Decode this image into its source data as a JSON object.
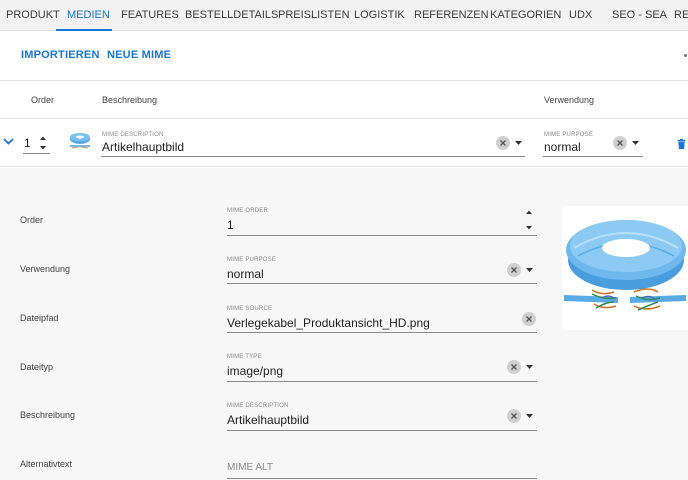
{
  "tabs": [
    "PRODUKT",
    "MEDIEN",
    "FEATURES",
    "BESTELLDETAILS",
    "PREISLISTEN",
    "LOGISTIK",
    "REFERENZEN",
    "KATEGORIEN",
    "UDX",
    "SEO - SEA",
    "REG"
  ],
  "active_tab": "MEDIEN",
  "actions": {
    "import_label": "IMPORTIEREN",
    "new_mime_label": "NEUE MIME"
  },
  "table": {
    "headers": {
      "order": "Order",
      "description": "Beschreibung",
      "usage": "Verwendung"
    },
    "row": {
      "order": "1",
      "description_label": "MIME DESCRIPTION",
      "description": "Artikelhauptbild",
      "purpose_label": "MIME PURPOSE",
      "purpose": "normal"
    }
  },
  "details": {
    "order": {
      "label": "Order",
      "field_label": "MIME ORDER",
      "value": "1"
    },
    "usage": {
      "label": "Verwendung",
      "field_label": "MIME PURPOSE",
      "value": "normal"
    },
    "path": {
      "label": "Dateipfad",
      "field_label": "MIME SOURCE",
      "value": "Verlegekabel_Produktansicht_HD.png"
    },
    "type": {
      "label": "Dateityp",
      "field_label": "MIME TYPE",
      "value": "image/png"
    },
    "description": {
      "label": "Beschreibung",
      "field_label": "MIME DESCRIPTION",
      "value": "Artikelhauptbild"
    },
    "alt": {
      "label": "Alternativtext",
      "placeholder": "MIME ALT"
    }
  },
  "icons": {
    "expand": "chevron-down-icon",
    "stepper": "stepper-arrows-icon",
    "clear": "clear-circle-icon",
    "dropdown": "caret-down-icon",
    "delete": "trash-icon",
    "preview": "cable-coil-image"
  },
  "colors": {
    "accent": "#1976d2",
    "tab_bar_bg": "#f2f2f2",
    "detail_bg": "#f7f7f7"
  }
}
